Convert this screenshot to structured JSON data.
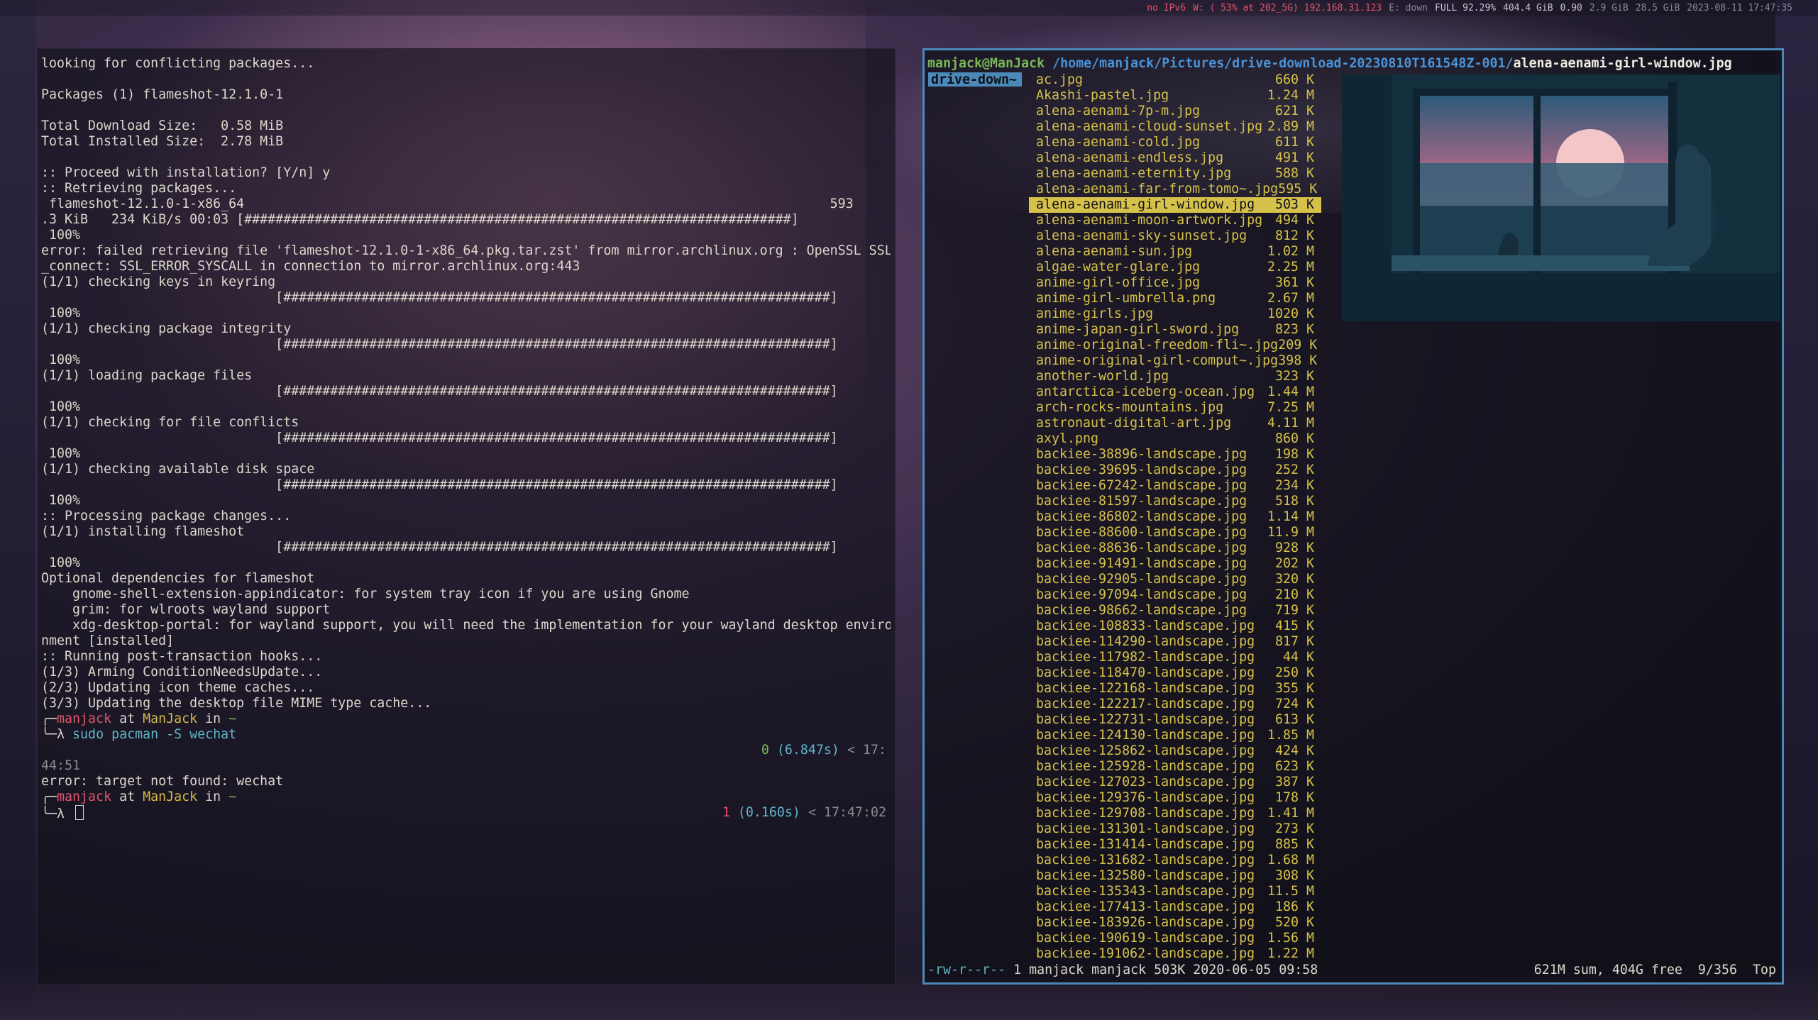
{
  "topbar": {
    "items": [
      {
        "text": "no IPv6",
        "tone": "red"
      },
      {
        "text": "W: ( 53% at 202_5G) 192.168.31.123",
        "tone": "red"
      },
      {
        "text": "E: down",
        "tone": "dim"
      },
      {
        "text": "FULL 92.29%",
        "tone": "normal"
      },
      {
        "text": "404.4 GiB",
        "tone": "normal"
      },
      {
        "text": "0.90",
        "tone": "normal"
      },
      {
        "text": "2.9 GiB",
        "tone": "dim"
      },
      {
        "text": "28.5 GiB",
        "tone": "dim"
      },
      {
        "text": "2023-08-11 17:47:35",
        "tone": "dim"
      }
    ]
  },
  "left_terminal": {
    "lines": [
      {
        "text": "looking for conflicting packages...",
        "tone": ""
      },
      {
        "text": "",
        "tone": ""
      },
      {
        "text": "Packages (1) flameshot-12.1.0-1",
        "tone": ""
      },
      {
        "text": "",
        "tone": ""
      },
      {
        "text": "Total Download Size:   0.58 MiB",
        "tone": ""
      },
      {
        "text": "Total Installed Size:  2.78 MiB",
        "tone": ""
      },
      {
        "text": "",
        "tone": ""
      },
      {
        "text": ":: Proceed with installation? [Y/n] y",
        "tone": ""
      },
      {
        "text": ":: Retrieving packages...",
        "tone": ""
      },
      {
        "text": " flameshot-12.1.0-1-x86_64                                                                           593",
        "tone": ""
      },
      {
        "text": ".3 KiB   234 KiB/s 00:03 [######################################################################]",
        "tone": ""
      },
      {
        "text": " 100%",
        "tone": ""
      },
      {
        "text": "error: failed retrieving file 'flameshot-12.1.0-1-x86_64.pkg.tar.zst' from mirror.archlinux.org : OpenSSL SSL",
        "tone": ""
      },
      {
        "text": "_connect: SSL_ERROR_SYSCALL in connection to mirror.archlinux.org:443",
        "tone": ""
      },
      {
        "text": "(1/1) checking keys in keyring",
        "tone": ""
      },
      {
        "text": "                              [######################################################################]",
        "tone": ""
      },
      {
        "text": " 100%",
        "tone": ""
      },
      {
        "text": "(1/1) checking package integrity",
        "tone": ""
      },
      {
        "text": "                              [######################################################################]",
        "tone": ""
      },
      {
        "text": " 100%",
        "tone": ""
      },
      {
        "text": "(1/1) loading package files",
        "tone": ""
      },
      {
        "text": "                              [######################################################################]",
        "tone": ""
      },
      {
        "text": " 100%",
        "tone": ""
      },
      {
        "text": "(1/1) checking for file conflicts",
        "tone": ""
      },
      {
        "text": "                              [######################################################################]",
        "tone": ""
      },
      {
        "text": " 100%",
        "tone": ""
      },
      {
        "text": "(1/1) checking available disk space",
        "tone": ""
      },
      {
        "text": "                              [######################################################################]",
        "tone": ""
      },
      {
        "text": " 100%",
        "tone": ""
      },
      {
        "text": ":: Processing package changes...",
        "tone": ""
      },
      {
        "text": "(1/1) installing flameshot",
        "tone": ""
      },
      {
        "text": "                              [######################################################################]",
        "tone": ""
      },
      {
        "text": " 100%",
        "tone": ""
      },
      {
        "text": "Optional dependencies for flameshot",
        "tone": ""
      },
      {
        "text": "    gnome-shell-extension-appindicator: for system tray icon if you are using Gnome",
        "tone": ""
      },
      {
        "text": "    grim: for wlroots wayland support",
        "tone": ""
      },
      {
        "text": "    xdg-desktop-portal: for wayland support, you will need the implementation for your wayland desktop enviro",
        "tone": ""
      },
      {
        "text": "nment [installed]",
        "tone": ""
      },
      {
        "text": ":: Running post-transaction hooks...",
        "tone": ""
      },
      {
        "text": "(1/3) Arming ConditionNeedsUpdate...",
        "tone": ""
      },
      {
        "text": "(2/3) Updating icon theme caches...",
        "tone": ""
      },
      {
        "text": "(3/3) Updating the desktop file MIME type cache...",
        "tone": ""
      }
    ],
    "prompt1": {
      "user": "manjack",
      "at": " at ",
      "host": "ManJack",
      "in": " in ",
      "dir": "~",
      "lambda": "λ",
      "command": "sudo pacman -S wechat",
      "exit_code": "0",
      "duration": "(6.847s)",
      "time": "< 17:",
      "time_wrap": "44:51"
    },
    "error_line": "error: target not found: wechat",
    "prompt2": {
      "user": "manjack",
      "at": " at ",
      "host": "ManJack",
      "in": " in ",
      "dir": "~",
      "lambda": "λ",
      "exit_code": "1",
      "duration": "(0.160s)",
      "time": "< 17:47:02"
    }
  },
  "ranger": {
    "path_user": "manjack@ManJack",
    "path_dir": "/home/manjack/Pictures/drive-download-20230810T161548Z-001/",
    "path_file": "alena-aenami-girl-window.jpg",
    "parent_label": "drive-down~",
    "files": [
      {
        "name": "ac.jpg",
        "size": "660 K"
      },
      {
        "name": "Akashi-pastel.jpg",
        "size": "1.24 M"
      },
      {
        "name": "alena-aenami-7p-m.jpg",
        "size": "621 K"
      },
      {
        "name": "alena-aenami-cloud-sunset.jpg",
        "size": "2.89 M"
      },
      {
        "name": "alena-aenami-cold.jpg",
        "size": "611 K"
      },
      {
        "name": "alena-aenami-endless.jpg",
        "size": "491 K"
      },
      {
        "name": "alena-aenami-eternity.jpg",
        "size": "588 K"
      },
      {
        "name": "alena-aenami-far-from-tomo~.jpg",
        "size": "595 K"
      },
      {
        "name": "alena-aenami-girl-window.jpg",
        "size": "503 K",
        "selected": true
      },
      {
        "name": "alena-aenami-moon-artwork.jpg",
        "size": "494 K"
      },
      {
        "name": "alena-aenami-sky-sunset.jpg",
        "size": "812 K"
      },
      {
        "name": "alena-aenami-sun.jpg",
        "size": "1.02 M"
      },
      {
        "name": "algae-water-glare.jpg",
        "size": "2.25 M"
      },
      {
        "name": "anime-girl-office.jpg",
        "size": "361 K"
      },
      {
        "name": "anime-girl-umbrella.png",
        "size": "2.67 M"
      },
      {
        "name": "anime-girls.jpg",
        "size": "1020 K"
      },
      {
        "name": "anime-japan-girl-sword.jpg",
        "size": "823 K"
      },
      {
        "name": "anime-original-freedom-fli~.jpg",
        "size": "209 K"
      },
      {
        "name": "anime-original-girl-comput~.jpg",
        "size": "398 K"
      },
      {
        "name": "another-world.jpg",
        "size": "323 K"
      },
      {
        "name": "antarctica-iceberg-ocean.jpg",
        "size": "1.44 M"
      },
      {
        "name": "arch-rocks-mountains.jpg",
        "size": "7.25 M"
      },
      {
        "name": "astronaut-digital-art.jpg",
        "size": "4.11 M"
      },
      {
        "name": "axyl.png",
        "size": "860 K"
      },
      {
        "name": "backiee-38896-landscape.jpg",
        "size": "198 K"
      },
      {
        "name": "backiee-39695-landscape.jpg",
        "size": "252 K"
      },
      {
        "name": "backiee-67242-landscape.jpg",
        "size": "234 K"
      },
      {
        "name": "backiee-81597-landscape.jpg",
        "size": "518 K"
      },
      {
        "name": "backiee-86802-landscape.jpg",
        "size": "1.14 M"
      },
      {
        "name": "backiee-88600-landscape.jpg",
        "size": "11.9 M"
      },
      {
        "name": "backiee-88636-landscape.jpg",
        "size": "928 K"
      },
      {
        "name": "backiee-91491-landscape.jpg",
        "size": "202 K"
      },
      {
        "name": "backiee-92905-landscape.jpg",
        "size": "320 K"
      },
      {
        "name": "backiee-97094-landscape.jpg",
        "size": "210 K"
      },
      {
        "name": "backiee-98662-landscape.jpg",
        "size": "719 K"
      },
      {
        "name": "backiee-108833-landscape.jpg",
        "size": "415 K"
      },
      {
        "name": "backiee-114290-landscape.jpg",
        "size": "817 K"
      },
      {
        "name": "backiee-117982-landscape.jpg",
        "size": "44 K"
      },
      {
        "name": "backiee-118470-landscape.jpg",
        "size": "250 K"
      },
      {
        "name": "backiee-122168-landscape.jpg",
        "size": "355 K"
      },
      {
        "name": "backiee-122217-landscape.jpg",
        "size": "724 K"
      },
      {
        "name": "backiee-122731-landscape.jpg",
        "size": "613 K"
      },
      {
        "name": "backiee-124130-landscape.jpg",
        "size": "1.85 M"
      },
      {
        "name": "backiee-125862-landscape.jpg",
        "size": "424 K"
      },
      {
        "name": "backiee-125928-landscape.jpg",
        "size": "623 K"
      },
      {
        "name": "backiee-127023-landscape.jpg",
        "size": "387 K"
      },
      {
        "name": "backiee-129376-landscape.jpg",
        "size": "178 K"
      },
      {
        "name": "backiee-129708-landscape.jpg",
        "size": "1.41 M"
      },
      {
        "name": "backiee-131301-landscape.jpg",
        "size": "273 K"
      },
      {
        "name": "backiee-131414-landscape.jpg",
        "size": "885 K"
      },
      {
        "name": "backiee-131682-landscape.jpg",
        "size": "1.68 M"
      },
      {
        "name": "backiee-132580-landscape.jpg",
        "size": "308 K"
      },
      {
        "name": "backiee-135343-landscape.jpg",
        "size": "11.5 M"
      },
      {
        "name": "backiee-177413-landscape.jpg",
        "size": "186 K"
      },
      {
        "name": "backiee-183926-landscape.jpg",
        "size": "520 K"
      },
      {
        "name": "backiee-190619-landscape.jpg",
        "size": "1.56 M"
      },
      {
        "name": "backiee-191062-landscape.jpg",
        "size": "1.22 M"
      }
    ],
    "status": {
      "perm": "-rw-r--r--",
      "info": " 1 manjack manjack 503K 2020-06-05 09:58",
      "summary": "621M sum, 404G free  9/356  Top"
    }
  },
  "colors": {
    "ranger_border": "#4a89b8",
    "selection": "#d6c24a",
    "file_color": "#d6c24a",
    "prompt_user": "#e0556a",
    "prompt_host": "#d6b84a",
    "prompt_cmd": "#5fb6c8"
  }
}
